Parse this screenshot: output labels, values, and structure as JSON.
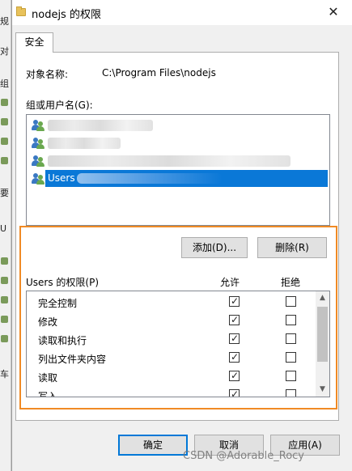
{
  "background_window": {
    "fragments": [
      "规",
      "对",
      "组",
      "要",
      "U",
      "车"
    ]
  },
  "dialog": {
    "title": "nodejs 的权限",
    "close_glyph": "✕"
  },
  "tabs": [
    {
      "label": "安全",
      "selected": true
    }
  ],
  "security": {
    "object_label": "对象名称:",
    "object_value": "C:\\Program Files\\nodejs",
    "group_label": "组或用户名(G):",
    "users": [
      {
        "label": "",
        "obscured": true
      },
      {
        "label": "",
        "obscured": true
      },
      {
        "label": "",
        "obscured": true
      },
      {
        "label": "Users",
        "selected": true
      }
    ],
    "add_button": "添加(D)...",
    "remove_button": "删除(R)",
    "permissions_title": "Users 的权限(P)",
    "allow_header": "允许",
    "deny_header": "拒绝",
    "permissions": [
      {
        "name": "完全控制",
        "allow": true,
        "deny": false
      },
      {
        "name": "修改",
        "allow": true,
        "deny": false
      },
      {
        "name": "读取和执行",
        "allow": true,
        "deny": false
      },
      {
        "name": "列出文件夹内容",
        "allow": true,
        "deny": false
      },
      {
        "name": "读取",
        "allow": true,
        "deny": false
      },
      {
        "name": "写入",
        "allow": true,
        "deny": false
      }
    ]
  },
  "footer": {
    "ok": "确定",
    "cancel": "取消",
    "apply": "应用(A)"
  },
  "colors": {
    "selection": "#0a78d7",
    "highlight_box": "#f08a24"
  },
  "watermark": "CSDN @Adorable_Rocy"
}
